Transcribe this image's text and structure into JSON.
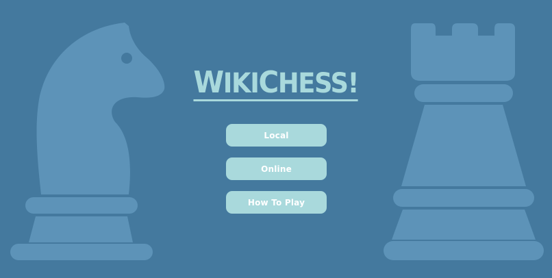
{
  "title": {
    "w": "W",
    "iki": "IKI",
    "c": "C",
    "hess": "HESS!"
  },
  "menu": {
    "local_label": "Local",
    "online_label": "Online",
    "how_to_play_label": "How To Play"
  },
  "colors": {
    "background": "#44799e",
    "piece": "#5d93b8",
    "accent": "#a9d9dc",
    "button_text": "#ffffff"
  },
  "icons": {
    "left_piece": "chess-knight-icon",
    "right_piece": "chess-rook-icon"
  }
}
